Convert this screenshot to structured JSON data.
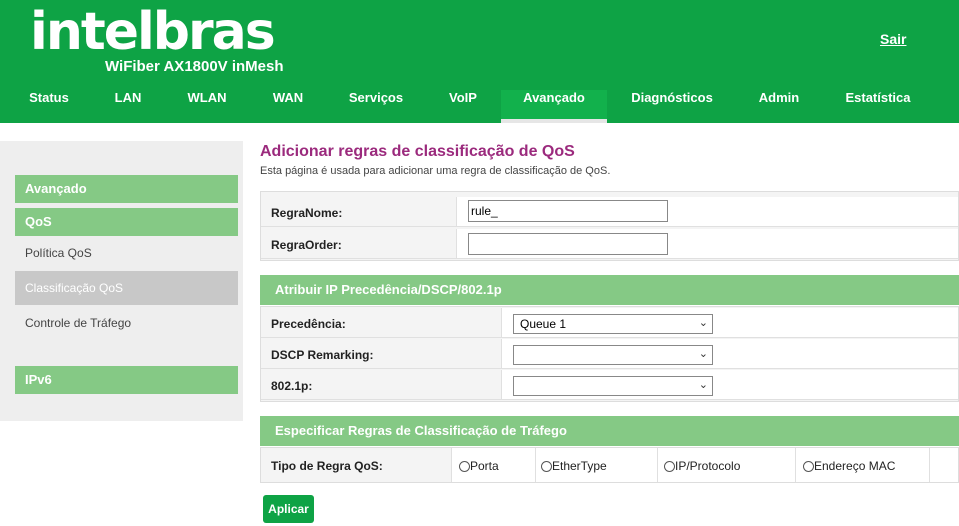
{
  "header": {
    "logo": "intelbras",
    "model": "WiFiber AX1800V inMesh",
    "logout": "Sair",
    "nav": [
      "Status",
      "LAN",
      "WLAN",
      "WAN",
      "Serviços",
      "VoIP",
      "Avançado",
      "Diagnósticos",
      "Admin",
      "Estatística"
    ],
    "active_nav": "Avançado"
  },
  "sidebar": {
    "section_advanced": "Avançado",
    "section_qos": "QoS",
    "items": [
      "Política QoS",
      "Classificação QoS",
      "Controle de Tráfego"
    ],
    "active_item": "Classificação QoS",
    "section_ipv6": "IPv6"
  },
  "page": {
    "title": "Adicionar regras de classificação de QoS",
    "subtitle": "Esta página é usada para adicionar uma regra de classificação de QoS."
  },
  "rule": {
    "name_label": "RegraNome:",
    "name_value": "rule_",
    "order_label": "RegraOrder:",
    "order_value": ""
  },
  "precedence_section": {
    "title": "Atribuir IP Precedência/DSCP/802.1p",
    "precedence_label": "Precedência:",
    "precedence_value": "Queue 1",
    "dscp_label": "DSCP Remarking:",
    "dscp_value": "",
    "p8021_label": "802.1p:",
    "p8021_value": ""
  },
  "classification_section": {
    "title": "Especificar Regras de Classificação de Tráfego",
    "type_label": "Tipo de Regra QoS:",
    "options": [
      "Porta",
      "EtherType",
      "IP/Protocolo",
      "Endereço MAC"
    ]
  },
  "actions": {
    "apply": "Aplicar"
  }
}
